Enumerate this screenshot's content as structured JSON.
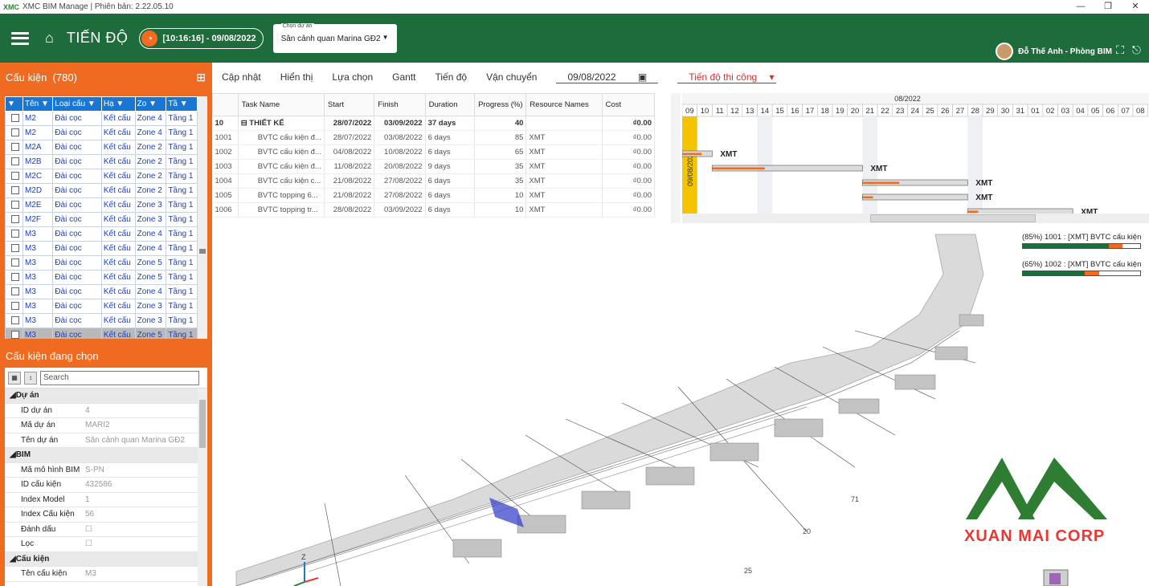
{
  "app": {
    "title": "XMC BIM Manage | Phiên bản: 2.22.05.10",
    "logo_text": "XMC"
  },
  "header": {
    "page_title": "TIẾN ĐỘ",
    "clock": "[10:16:16] - 09/08/2022",
    "project_label": "Chọn dự án",
    "project_value": "Sân cảnh quan Marina GĐ2",
    "user": "Đỗ Thế Anh - Phòng BIM"
  },
  "left": {
    "components_title": "Cấu kiện",
    "components_count": "(780)",
    "columns": [
      "",
      "Tên",
      "Loại cấu",
      "Hạ",
      "Zo",
      "Tầ"
    ],
    "rows": [
      [
        "M2",
        "Đài cọc",
        "Kết cấu",
        "Zone 4",
        "Tầng 1"
      ],
      [
        "M2",
        "Đài cọc",
        "Kết cấu",
        "Zone 4",
        "Tầng 1"
      ],
      [
        "M2A",
        "Đài cọc",
        "Kết cấu",
        "Zone 2",
        "Tầng 1"
      ],
      [
        "M2B",
        "Đài cọc",
        "Kết cấu",
        "Zone 2",
        "Tầng 1"
      ],
      [
        "M2C",
        "Đài cọc",
        "Kết cấu",
        "Zone 2",
        "Tầng 1"
      ],
      [
        "M2D",
        "Đài cọc",
        "Kết cấu",
        "Zone 2",
        "Tầng 1"
      ],
      [
        "M2E",
        "Đài cọc",
        "Kết cấu",
        "Zone 3",
        "Tầng 1"
      ],
      [
        "M2F",
        "Đài cọc",
        "Kết cấu",
        "Zone 3",
        "Tầng 1"
      ],
      [
        "M3",
        "Đài cọc",
        "Kết cấu",
        "Zone 4",
        "Tầng 1"
      ],
      [
        "M3",
        "Đài cọc",
        "Kết cấu",
        "Zone 4",
        "Tầng 1"
      ],
      [
        "M3",
        "Đài cọc",
        "Kết cấu",
        "Zone 5",
        "Tầng 1"
      ],
      [
        "M3",
        "Đài cọc",
        "Kết cấu",
        "Zone 5",
        "Tầng 1"
      ],
      [
        "M3",
        "Đài cọc",
        "Kết cấu",
        "Zone 4",
        "Tầng 1"
      ],
      [
        "M3",
        "Đài cọc",
        "Kết cấu",
        "Zone 3",
        "Tầng 1"
      ],
      [
        "M3",
        "Đài cọc",
        "Kết cấu",
        "Zone 3",
        "Tầng 1"
      ],
      [
        "M3",
        "Đài cọc",
        "Kết cấu",
        "Zone 5",
        "Tầng 1"
      ]
    ],
    "selected_title": "Cấu kiện đang chọn",
    "search_placeholder": "Search",
    "properties": [
      {
        "cat": "Dự án"
      },
      {
        "k": "ID dự án",
        "v": "4"
      },
      {
        "k": "Mã dự án",
        "v": "MARI2"
      },
      {
        "k": "Tên dự án",
        "v": "Sân cảnh quan Marina GĐ2"
      },
      {
        "cat": "BIM"
      },
      {
        "k": "Mã mô hình BIM",
        "v": "S-PN"
      },
      {
        "k": "ID cấu kiện",
        "v": "432586"
      },
      {
        "k": "Index Model",
        "v": "1"
      },
      {
        "k": "Index Cấu kiện",
        "v": "56"
      },
      {
        "k": "Đánh dấu",
        "v": "☐"
      },
      {
        "k": "Lọc",
        "v": "☐"
      },
      {
        "cat": "Cấu kiện"
      },
      {
        "k": "Tên cấu kiện",
        "v": "M3"
      }
    ]
  },
  "menu": {
    "items": [
      "Cập nhật",
      "Hiển thị",
      "Lựa chọn",
      "Gantt",
      "Tiến độ",
      "Vận chuyển"
    ],
    "date": "09/08/2022",
    "schedule": "Tiến độ thi công"
  },
  "tasks": {
    "columns": [
      "",
      "Task Name",
      "Start",
      "Finish",
      "Duration",
      "Progress (%)",
      "Resource Names",
      "Cost"
    ],
    "rows": [
      {
        "id": "10",
        "name": "THIẾT KẾ",
        "start": "28/07/2022",
        "finish": "03/09/2022",
        "dur": "37 days",
        "prog": "40",
        "res": "",
        "cost": "₫0.00",
        "sum": true
      },
      {
        "id": "1001",
        "name": "BVTC cấu kiện đ...",
        "start": "28/07/2022",
        "finish": "03/08/2022",
        "dur": "6 days",
        "prog": "85",
        "res": "XMT",
        "cost": "₫0.00"
      },
      {
        "id": "1002",
        "name": "BVTC cấu kiện đ...",
        "start": "04/08/2022",
        "finish": "10/08/2022",
        "dur": "6 days",
        "prog": "65",
        "res": "XMT",
        "cost": "₫0.00"
      },
      {
        "id": "1003",
        "name": "BVTC cấu kiện đ...",
        "start": "11/08/2022",
        "finish": "20/08/2022",
        "dur": "9 days",
        "prog": "35",
        "res": "XMT",
        "cost": "₫0.00"
      },
      {
        "id": "1004",
        "name": "BVTC cấu kiện c...",
        "start": "21/08/2022",
        "finish": "27/08/2022",
        "dur": "6 days",
        "prog": "35",
        "res": "XMT",
        "cost": "₫0.00"
      },
      {
        "id": "1005",
        "name": "BVTC topping 6...",
        "start": "21/08/2022",
        "finish": "27/08/2022",
        "dur": "6 days",
        "prog": "10",
        "res": "XMT",
        "cost": "₫0.00"
      },
      {
        "id": "1006",
        "name": "BVTC topping tr...",
        "start": "28/08/2022",
        "finish": "03/09/2022",
        "dur": "6 days",
        "prog": "10",
        "res": "XMT",
        "cost": "₫0.00"
      }
    ]
  },
  "gantt": {
    "month": "08/2022",
    "days": [
      "09",
      "10",
      "11",
      "12",
      "13",
      "14",
      "15",
      "16",
      "17",
      "18",
      "19",
      "20",
      "21",
      "22",
      "23",
      "24",
      "25",
      "26",
      "27",
      "28",
      "29",
      "30",
      "31",
      "01",
      "02",
      "03",
      "04",
      "05",
      "06",
      "07",
      "08"
    ],
    "today": "09/08/2022",
    "resource": "XMT"
  },
  "viewer": {
    "legend1": "(85%) 1001 : [XMT] BVTC cấu kiện",
    "legend1_progress": 0.85,
    "legend2": "(65%) 1002 : [XMT] BVTC cấu kiện",
    "legend2_progress": 0.65,
    "corp": "XUAN MAI CORP",
    "axis_labels": [
      "20",
      "25",
      "71"
    ]
  }
}
